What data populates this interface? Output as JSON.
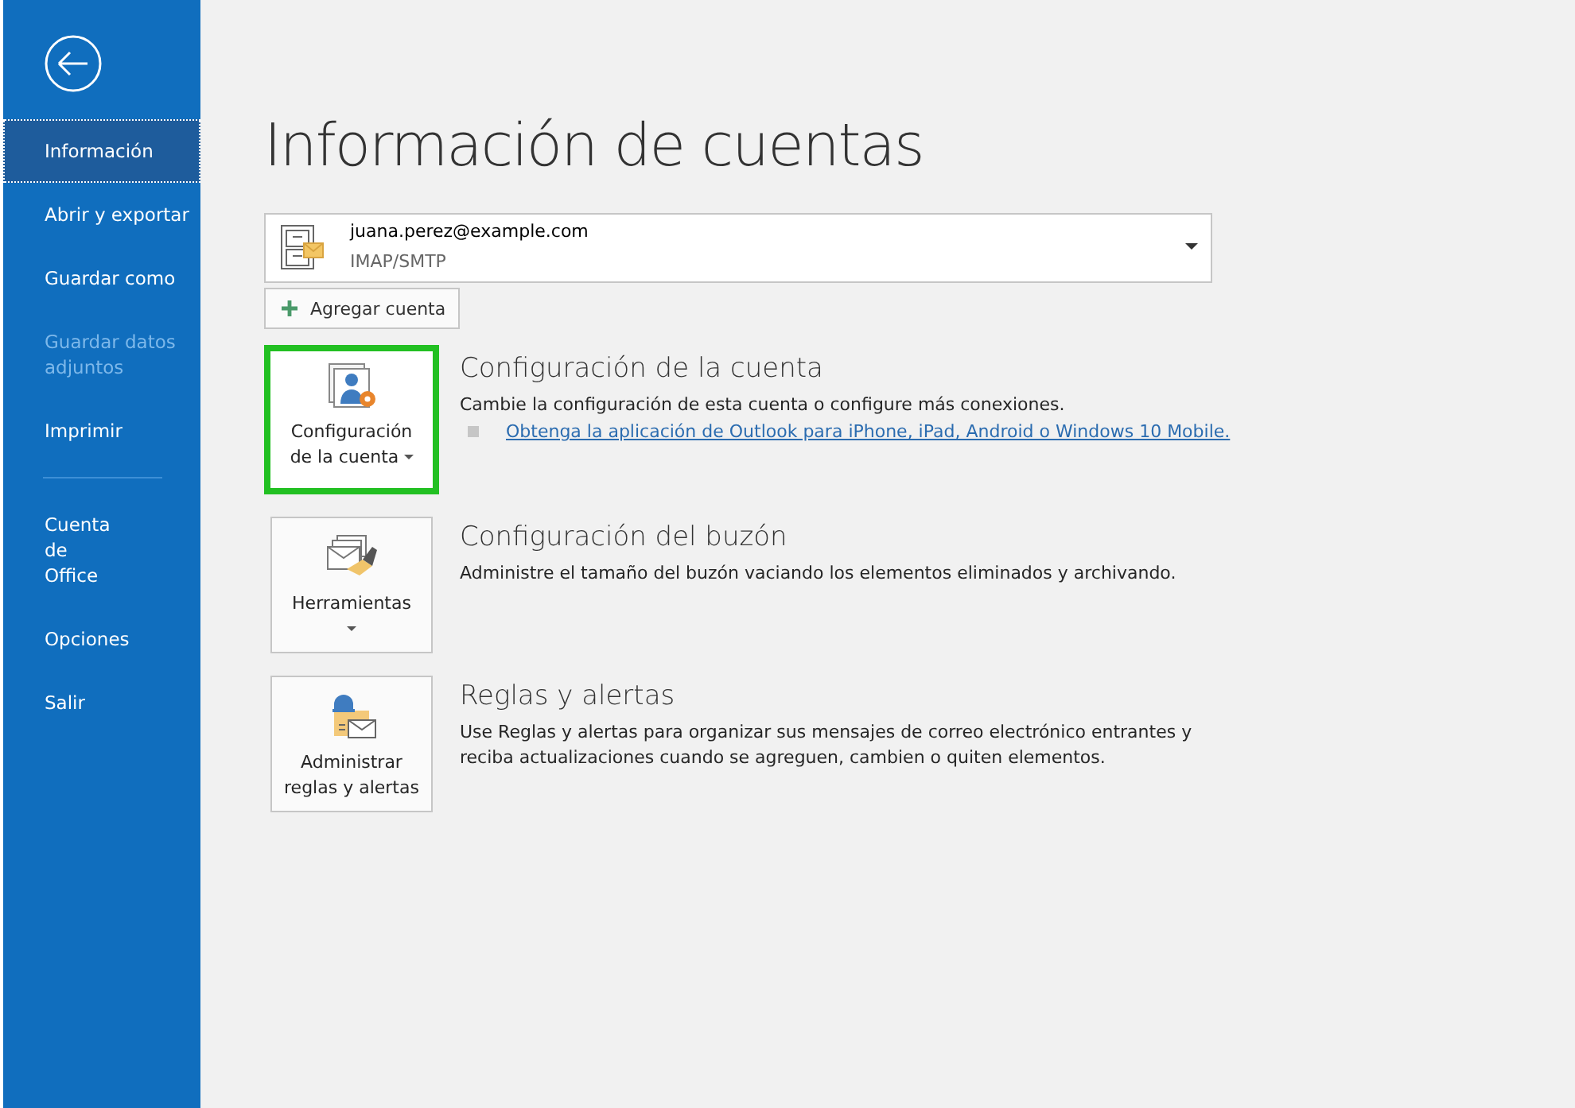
{
  "sidebar": {
    "items": [
      {
        "kind": "item",
        "lines": [
          "Información"
        ],
        "selected": true,
        "disabled": false
      },
      {
        "kind": "item",
        "lines": [
          "Abrir y exportar"
        ],
        "selected": false,
        "disabled": false
      },
      {
        "kind": "item",
        "lines": [
          "Guardar como"
        ],
        "selected": false,
        "disabled": false
      },
      {
        "kind": "item",
        "lines": [
          "Guardar datos",
          "adjuntos"
        ],
        "selected": false,
        "disabled": true
      },
      {
        "kind": "item",
        "lines": [
          "Imprimir"
        ],
        "selected": false,
        "disabled": false
      },
      {
        "kind": "divider"
      },
      {
        "kind": "item",
        "lines": [
          "Cuenta",
          "de",
          "Office"
        ],
        "selected": false,
        "disabled": false
      },
      {
        "kind": "item",
        "lines": [
          "Opciones"
        ],
        "selected": false,
        "disabled": false
      },
      {
        "kind": "item",
        "lines": [
          "Salir"
        ],
        "selected": false,
        "disabled": false
      }
    ]
  },
  "page_title": "Información de cuentas",
  "account": {
    "email": "juana.perez@example.com",
    "type": "IMAP/SMTP"
  },
  "add_account": "Agregar cuenta",
  "sections": [
    {
      "button_lines": [
        "Configuración",
        "de la cuenta"
      ],
      "has_caret": true,
      "highlighted": true,
      "title": "Configuración de la cuenta",
      "description": "Cambie la configuración de esta cuenta o configure más conexiones.",
      "link": "Obtenga la aplicación de Outlook para iPhone, iPad, Android o Windows 10 Mobile."
    },
    {
      "button_lines": [
        "Herramientas"
      ],
      "has_caret": true,
      "highlighted": false,
      "title": "Configuración del buzón",
      "description": "Administre el tamaño del buzón vaciando los elementos eliminados y archivando."
    },
    {
      "button_lines": [
        "Administrar",
        "reglas y alertas"
      ],
      "has_caret": false,
      "highlighted": false,
      "title": "Reglas y alertas",
      "description": "Use Reglas y alertas para organizar sus mensajes de correo electrónico entrantes y reciba actualizaciones cuando se agreguen, cambien o quiten elementos."
    }
  ]
}
